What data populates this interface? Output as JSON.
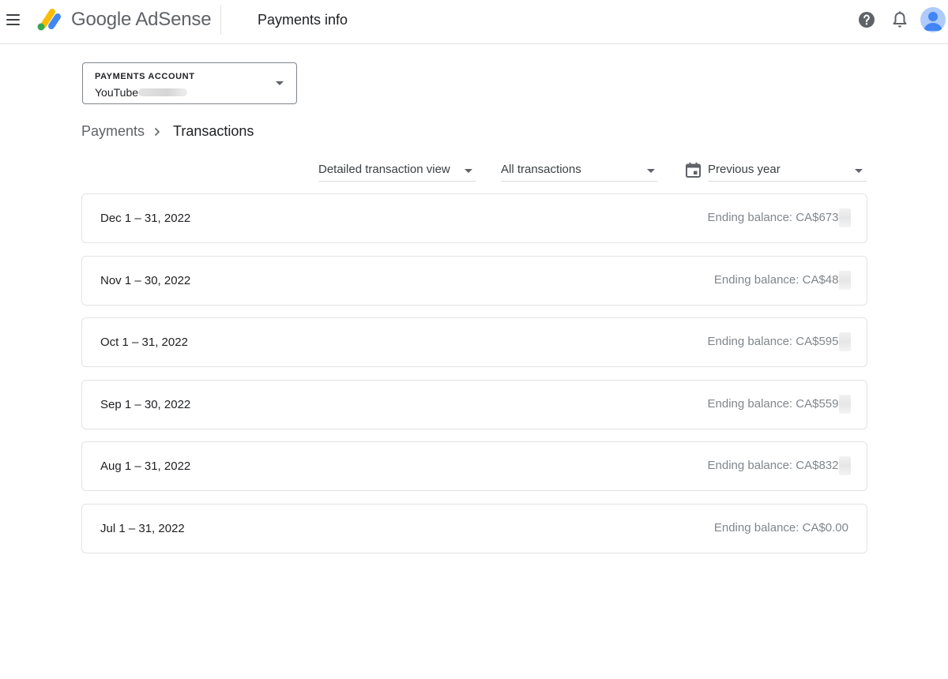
{
  "header": {
    "brand": "Google AdSense",
    "page_title": "Payments info",
    "icons": [
      "menu-icon",
      "adsense-logo",
      "help-icon",
      "bell-icon",
      "avatar"
    ]
  },
  "account": {
    "label": "PAYMENTS ACCOUNT",
    "value": "YouTube"
  },
  "breadcrumb": {
    "parent": "Payments",
    "current": "Transactions"
  },
  "filters": {
    "view": "Detailed transaction view",
    "type": "All transactions",
    "period": "Previous year"
  },
  "months": [
    {
      "period": "Dec 1 – 31, 2022",
      "balance": "Ending balance: CA$673.0"
    },
    {
      "period": "Nov 1 – 30, 2022",
      "balance": "Ending balance: CA$484."
    },
    {
      "period": "Oct 1 – 31, 2022",
      "balance": "Ending balance: CA$595.2"
    },
    {
      "period": "Sep 1 – 30, 2022",
      "balance": "Ending balance: CA$559.0"
    },
    {
      "period": "Aug 1 – 31, 2022",
      "balance": "Ending balance: CA$832.9"
    },
    {
      "period": "Jul 1 – 31, 2022",
      "balance": "Ending balance: CA$0.00"
    }
  ],
  "colors": {
    "logo_yellow": "#fbbc04",
    "logo_blue": "#4285f4",
    "logo_green": "#34a853",
    "avatar_bg": "#aecbfa",
    "avatar_fg": "#4285f4"
  }
}
